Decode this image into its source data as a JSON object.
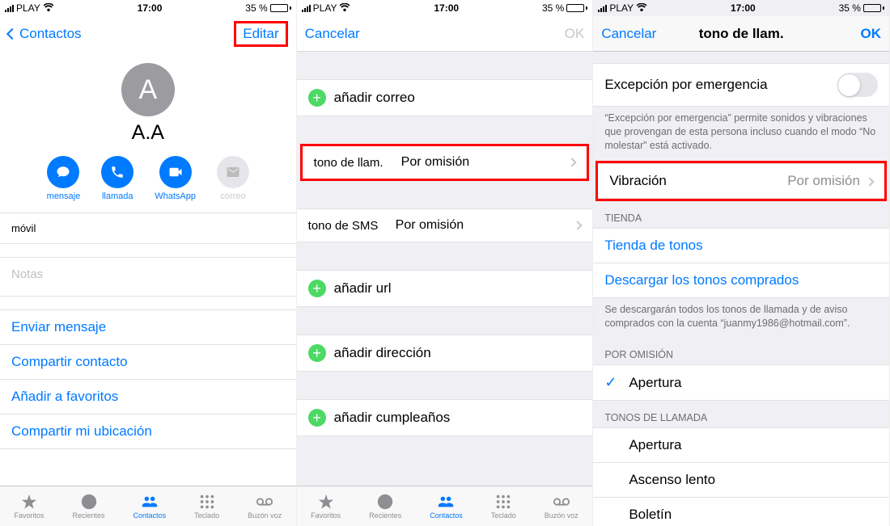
{
  "status": {
    "carrier": "PLAY",
    "time": "17:00",
    "battery_pct": "35 %"
  },
  "screen1": {
    "back": "Contactos",
    "edit": "Editar",
    "avatar_letter": "A",
    "contact_name": "A.A",
    "actions": {
      "message": "mensaje",
      "call": "llamada",
      "whatsapp": "WhatsApp",
      "mail": "correo"
    },
    "mobile_label": "móvil",
    "notes": "Notas",
    "links": {
      "send_msg": "Enviar mensaje",
      "share": "Compartir contacto",
      "fav": "Añadir a favoritos",
      "loc": "Compartir mi ubicación"
    }
  },
  "tabs": {
    "fav": "Favoritos",
    "recent": "Recientes",
    "contacts": "Contactos",
    "keypad": "Teclado",
    "voicemail": "Buzón voz"
  },
  "screen2": {
    "cancel": "Cancelar",
    "ok": "OK",
    "add_mail": "añadir correo",
    "ringtone_k": "tono de llam.",
    "ringtone_v": "Por omisión",
    "sms_k": "tono de SMS",
    "sms_v": "Por omisión",
    "add_url": "añadir url",
    "add_addr": "añadir dirección",
    "add_bday": "añadir cumpleaños"
  },
  "screen3": {
    "cancel": "Cancelar",
    "title": "tono de llam.",
    "ok": "OK",
    "emergency": "Excepción por emergencia",
    "emergency_foot": "“Excepción por emergencia” permite sonidos y vibraciones que provengan de esta persona incluso cuando el modo “No molestar” está activado.",
    "vibration": "Vibración",
    "vibration_val": "Por omisión",
    "store_hdr": "TIENDA",
    "store_link": "Tienda de tonos",
    "download_link": "Descargar los tonos comprados",
    "download_foot": "Se descargarán todos los tonos de llamada y de aviso comprados con la cuenta “juanmy1986@hotmail.com”.",
    "default_hdr": "POR OMISIÓN",
    "default_tone": "Apertura",
    "ringtones_hdr": "TONOS DE LLAMADA",
    "tone1": "Apertura",
    "tone2": "Ascenso lento",
    "tone3": "Boletín"
  }
}
